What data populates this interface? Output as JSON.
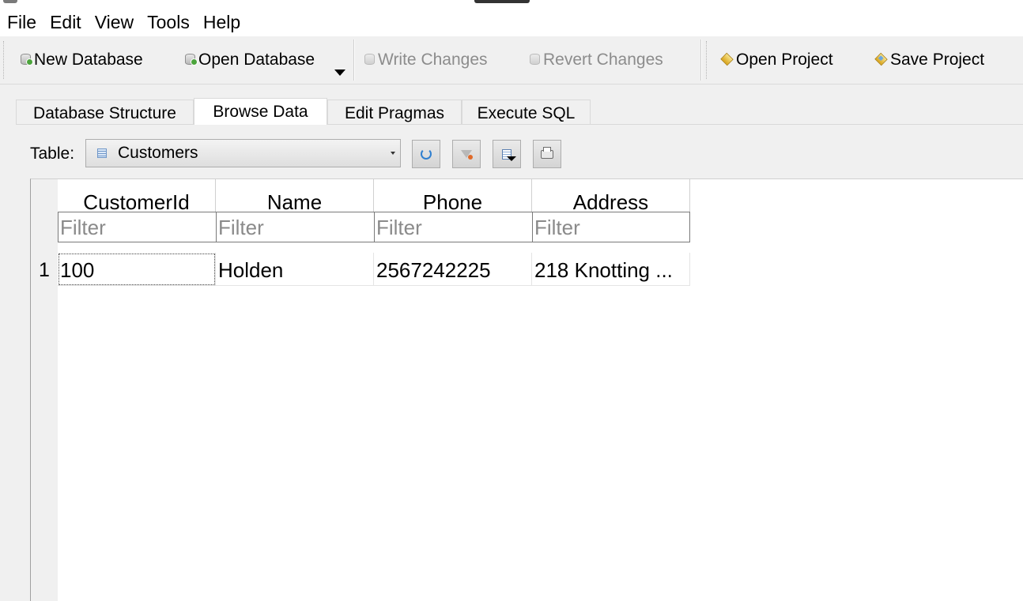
{
  "menu": {
    "items": [
      "File",
      "Edit",
      "View",
      "Tools",
      "Help"
    ]
  },
  "toolbar": {
    "new_database": "New Database",
    "open_database": "Open Database",
    "write_changes": "Write Changes",
    "revert_changes": "Revert Changes",
    "open_project": "Open Project",
    "save_project": "Save Project"
  },
  "tabs": [
    {
      "label": "Database Structure",
      "active": false
    },
    {
      "label": "Browse Data",
      "active": true
    },
    {
      "label": "Edit Pragmas",
      "active": false
    },
    {
      "label": "Execute SQL",
      "active": false
    }
  ],
  "browse": {
    "table_label": "Table:",
    "selected_table": "Customers"
  },
  "grid": {
    "columns": [
      "CustomerId",
      "Name",
      "Phone",
      "Address"
    ],
    "filter_placeholder": "Filter",
    "rows": [
      {
        "num": "1",
        "cells": [
          "100",
          "Holden",
          "2567242225",
          "218 Knotting ..."
        ]
      }
    ]
  },
  "colors": {
    "window_bg": "#f0f0f0",
    "grid_bg": "#ffffff",
    "disabled_text": "#8c8c8c"
  }
}
